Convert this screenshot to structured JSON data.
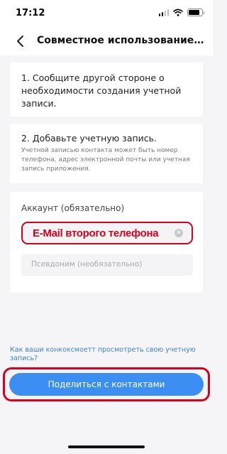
{
  "status_bar": {
    "time": "17:12",
    "signal_bars_active": 2,
    "battery_level": 0.85
  },
  "nav": {
    "title": "Совместное использование обор..."
  },
  "steps": {
    "step1": {
      "title": "1. Сообщите другой стороне о необходимости создания учетной записи."
    },
    "step2": {
      "title": "2. Добавьте учетную запись.",
      "description": "Учетной записью контакта может быть номер телефона, адрес электронной почты или учетная запись приложения."
    }
  },
  "account": {
    "label": "Аккаунт (обязательно)",
    "email_value": "E-Mail второго телефона",
    "alias_placeholder": "Псевдоним (необязательно)"
  },
  "help_link": "Как ваши конкоксмоетт просмотреть свою учетную запись?",
  "share_button": "Поделиться с контактами",
  "colors": {
    "accent": "#3b8ff2",
    "highlight": "#d8001f",
    "link": "#3a82c6"
  }
}
